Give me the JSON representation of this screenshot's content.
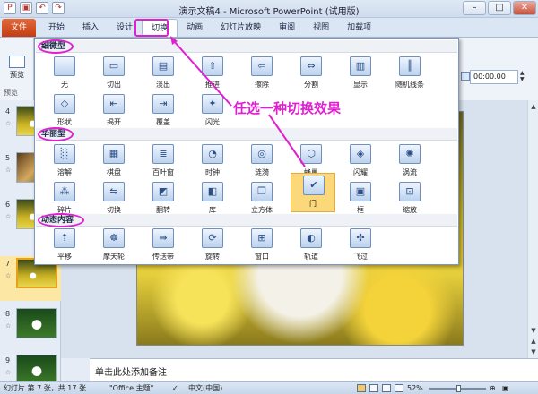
{
  "window": {
    "title": "演示文稿4 - Microsoft PowerPoint (试用版)",
    "controls": [
      "–",
      "□",
      "✕"
    ]
  },
  "qat": {
    "save_icon": "save-icon",
    "undo_icon": "undo-icon",
    "redo_icon": "redo-icon"
  },
  "tabs": [
    {
      "label": "文件"
    },
    {
      "label": "开始"
    },
    {
      "label": "插入"
    },
    {
      "label": "设计"
    },
    {
      "label": "切换"
    },
    {
      "label": "动画"
    },
    {
      "label": "幻灯片放映"
    },
    {
      "label": "审阅"
    },
    {
      "label": "视图"
    },
    {
      "label": "加载项"
    }
  ],
  "ribbon": {
    "preview_label": "预览",
    "preview_group": "预览",
    "duration_value": "00:00.00"
  },
  "gallery": {
    "categories": [
      {
        "name": "细微型",
        "items": [
          {
            "label": "无",
            "icon": "none"
          },
          {
            "label": "切出",
            "icon": "cut"
          },
          {
            "label": "淡出",
            "icon": "fade"
          },
          {
            "label": "推进",
            "icon": "push"
          },
          {
            "label": "擦除",
            "icon": "wipe"
          },
          {
            "label": "分割",
            "icon": "split"
          },
          {
            "label": "显示",
            "icon": "reveal"
          },
          {
            "label": "随机线条",
            "icon": "random-bars"
          },
          {
            "label": "形状",
            "icon": "shape"
          },
          {
            "label": "揭开",
            "icon": "uncover"
          },
          {
            "label": "覆盖",
            "icon": "cover"
          },
          {
            "label": "闪光",
            "icon": "flash"
          }
        ]
      },
      {
        "name": "华丽型",
        "items": [
          {
            "label": "溶解",
            "icon": "dissolve"
          },
          {
            "label": "棋盘",
            "icon": "checkerboard"
          },
          {
            "label": "百叶窗",
            "icon": "blinds"
          },
          {
            "label": "时钟",
            "icon": "clock"
          },
          {
            "label": "涟漪",
            "icon": "ripple"
          },
          {
            "label": "蜂巢",
            "icon": "honeycomb"
          },
          {
            "label": "闪耀",
            "icon": "glitter"
          },
          {
            "label": "涡流",
            "icon": "vortex"
          },
          {
            "label": "碎片",
            "icon": "shred"
          },
          {
            "label": "切换",
            "icon": "switch"
          },
          {
            "label": "翻转",
            "icon": "flip"
          },
          {
            "label": "库",
            "icon": "gallery"
          },
          {
            "label": "立方体",
            "icon": "cube"
          },
          {
            "label": "门",
            "icon": "doors"
          },
          {
            "label": "框",
            "icon": "box"
          },
          {
            "label": "缩放",
            "icon": "zoom"
          }
        ]
      },
      {
        "name": "动态内容",
        "items": [
          {
            "label": "平移",
            "icon": "pan"
          },
          {
            "label": "摩天轮",
            "icon": "ferris-wheel"
          },
          {
            "label": "传送带",
            "icon": "conveyor"
          },
          {
            "label": "旋转",
            "icon": "rotate"
          },
          {
            "label": "窗口",
            "icon": "window"
          },
          {
            "label": "轨道",
            "icon": "orbit"
          },
          {
            "label": "飞过",
            "icon": "fly-through"
          }
        ]
      }
    ],
    "selected": "门"
  },
  "annotation": "任选一种切换效果",
  "slides": [
    {
      "num": "4"
    },
    {
      "num": "5"
    },
    {
      "num": "6"
    },
    {
      "num": "7"
    },
    {
      "num": "8"
    },
    {
      "num": "9"
    }
  ],
  "notes_placeholder": "单击此处添加备注",
  "status": {
    "slide_info": "幻灯片 第 7 张，共 17 张",
    "theme": "\"Office 主题\"",
    "language": "中文(中国)",
    "zoom": "52%"
  }
}
